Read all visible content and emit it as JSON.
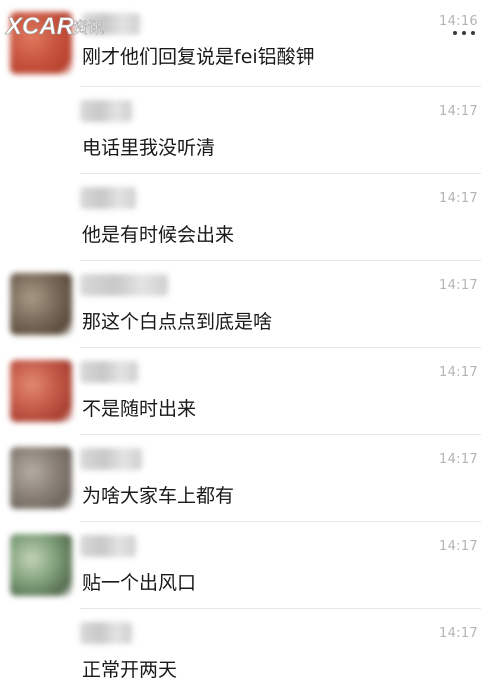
{
  "watermark": {
    "text": "XCAR资讯"
  },
  "more_icon": "more-dots-icon",
  "messages": [
    {
      "time": "14:16",
      "text": "刚才他们回复说是fei铝酸钾",
      "avatar_colors": [
        "#c8553f",
        "#e07a5f",
        "#b8412e"
      ]
    },
    {
      "time": "14:17",
      "text": "电话里我没听清",
      "avatar_colors": [
        "#ffffff",
        "#ffffff",
        "#ffffff"
      ]
    },
    {
      "time": "14:17",
      "text": "他是有时候会出来",
      "avatar_colors": [
        "#ffffff",
        "#ffffff",
        "#ffffff"
      ]
    },
    {
      "time": "14:17",
      "text": "那这个白点点到底是啥",
      "avatar_colors": [
        "#7a6a5a",
        "#a89885",
        "#5a4a3a"
      ]
    },
    {
      "time": "14:17",
      "text": "不是随时出来",
      "avatar_colors": [
        "#c45a48",
        "#e28a72",
        "#a63e30"
      ]
    },
    {
      "time": "14:17",
      "text": "为啥大家车上都有",
      "avatar_colors": [
        "#8a8178",
        "#b5ada4",
        "#6e655c"
      ]
    },
    {
      "time": "14:17",
      "text": "贴一个出风口",
      "avatar_colors": [
        "#7fa07a",
        "#c4d3b8",
        "#556b4f"
      ]
    },
    {
      "time": "14:17",
      "text": "正常开两天",
      "avatar_colors": [
        "#ffffff",
        "#ffffff",
        "#ffffff"
      ]
    }
  ]
}
